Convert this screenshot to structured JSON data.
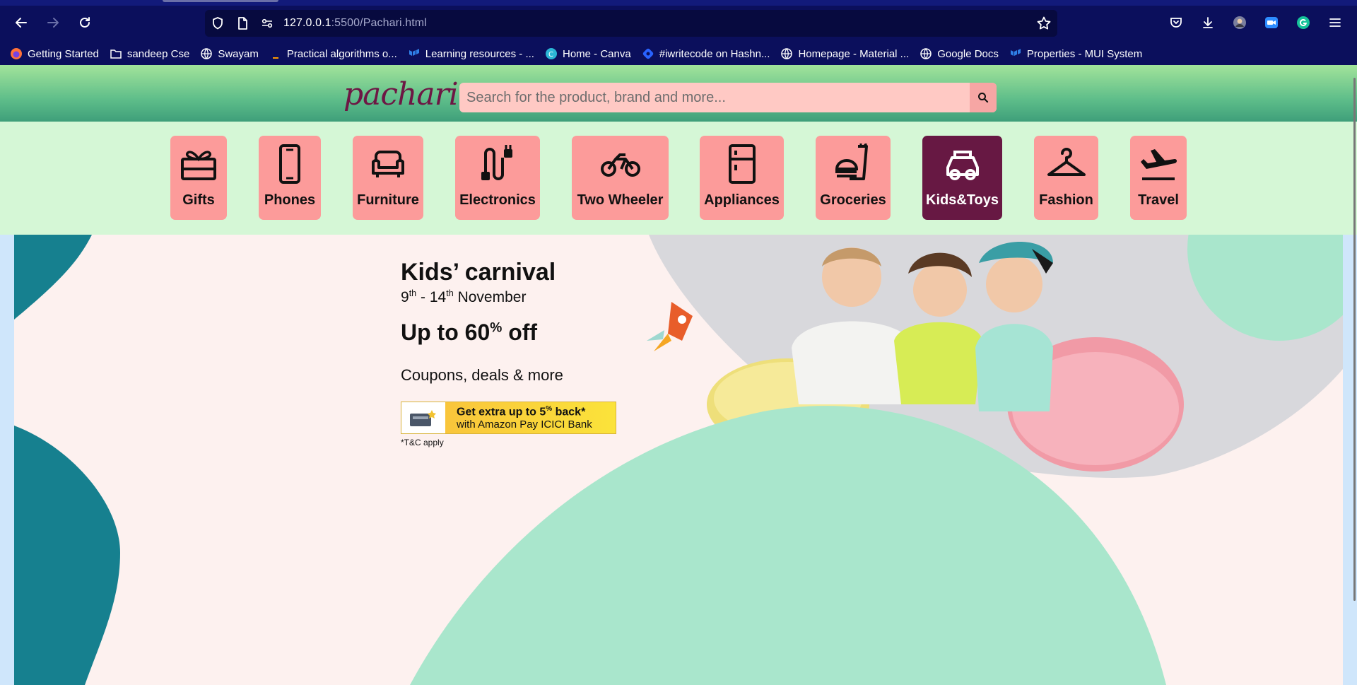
{
  "browser": {
    "url_host": "127.0.0.1",
    "url_path": ":5500/Pachari.html",
    "bookmarks": [
      {
        "label": "Getting Started",
        "icon": "firefox-icon"
      },
      {
        "label": "sandeep Cse",
        "icon": "folder-icon"
      },
      {
        "label": "Swayam",
        "icon": "globe-icon"
      },
      {
        "label": "Practical algorithms o...",
        "icon": "bookmark-page-icon"
      },
      {
        "label": "Learning resources - ...",
        "icon": "mui-icon"
      },
      {
        "label": "Home - Canva",
        "icon": "canva-icon"
      },
      {
        "label": "#iwritecode on Hashn...",
        "icon": "hashnode-icon"
      },
      {
        "label": "Homepage - Material ...",
        "icon": "globe-icon"
      },
      {
        "label": "Google Docs",
        "icon": "globe-icon"
      },
      {
        "label": "Properties - MUI System",
        "icon": "mui-icon"
      }
    ]
  },
  "site": {
    "logo": "pachari",
    "search": {
      "placeholder": "Search for the product, brand and more..."
    },
    "categories": [
      {
        "label": "Gifts",
        "icon": "gift-icon"
      },
      {
        "label": "Phones",
        "icon": "phone-icon"
      },
      {
        "label": "Furniture",
        "icon": "sofa-icon"
      },
      {
        "label": "Electronics",
        "icon": "cable-icon"
      },
      {
        "label": "Two Wheeler",
        "icon": "motorcycle-icon"
      },
      {
        "label": "Appliances",
        "icon": "fridge-icon"
      },
      {
        "label": "Groceries",
        "icon": "groceries-icon"
      },
      {
        "label": "Kids&Toys",
        "icon": "toy-car-icon",
        "active": true
      },
      {
        "label": "Fashion",
        "icon": "hanger-icon"
      },
      {
        "label": "Travel",
        "icon": "plane-icon"
      }
    ],
    "banner": {
      "title": "Kids’ carnival",
      "date_start": "9",
      "date_start_sup": "th",
      "date_sep": " - 14",
      "date_end_sup": "th",
      "date_month": " November",
      "offer_prefix": "Up to 60",
      "offer_sup": "%",
      "offer_suffix": " off",
      "coupons": "Coupons, deals & more",
      "card_line1": "Get extra up to 5",
      "card_line1_sup": "%",
      "card_line1_end": " back*",
      "card_line2": "with Amazon Pay ICICI Bank",
      "tc": "*T&C apply"
    }
  },
  "colors": {
    "chrome": "#0b0f5c",
    "header_green": "#5fbe8a",
    "strip": "#d5f7d6",
    "category": "#fc9b9a",
    "category_active": "#671843",
    "logo": "#6d1744",
    "search": "#ffc9c4"
  }
}
